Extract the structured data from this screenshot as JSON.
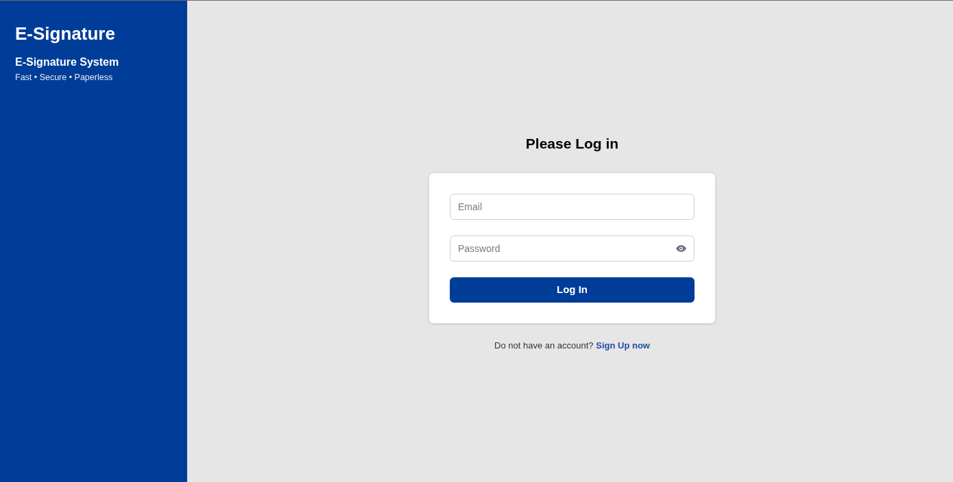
{
  "sidebar": {
    "title": "E-Signature",
    "subtitle": "E-Signature System",
    "tagline": "Fast • Secure • Paperless"
  },
  "login": {
    "heading": "Please Log in",
    "fields": [
      {
        "kind": "email",
        "placeholder": "Email"
      },
      {
        "kind": "password",
        "placeholder": "Password"
      }
    ],
    "submit": "Log In"
  },
  "signup": {
    "prompt": "Do not have an account?",
    "link": "Sign Up now"
  }
}
